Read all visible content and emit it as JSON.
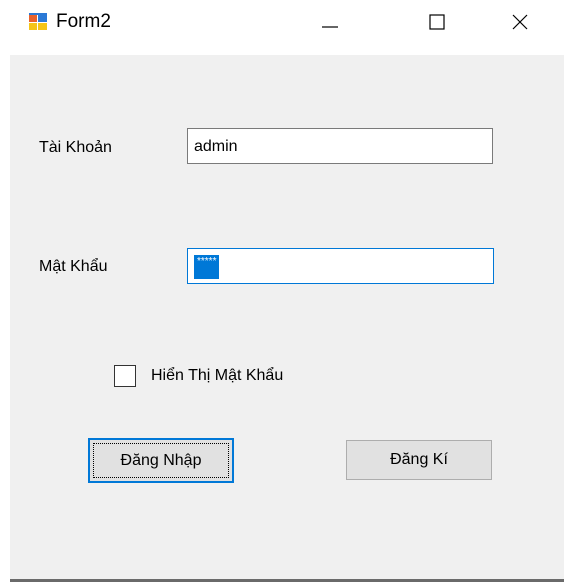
{
  "window": {
    "title": "Form2",
    "icon": "winforms-app-icon",
    "controls": {
      "minimize_icon": "minimize-icon",
      "maximize_icon": "maximize-icon",
      "close_icon": "close-icon"
    }
  },
  "form": {
    "username_label": "Tài Khoản",
    "username_value": "admin",
    "password_label": "Mật Khẩu",
    "password_value": "*****",
    "show_password_label": "Hiển Thị Mật Khẩu",
    "show_password_checked": false,
    "login_button": "Đăng Nhập",
    "register_button": "Đăng Kí"
  },
  "colors": {
    "accent": "#0078d7",
    "client_bg": "#f0f0f0",
    "button_bg": "#e1e1e1"
  }
}
